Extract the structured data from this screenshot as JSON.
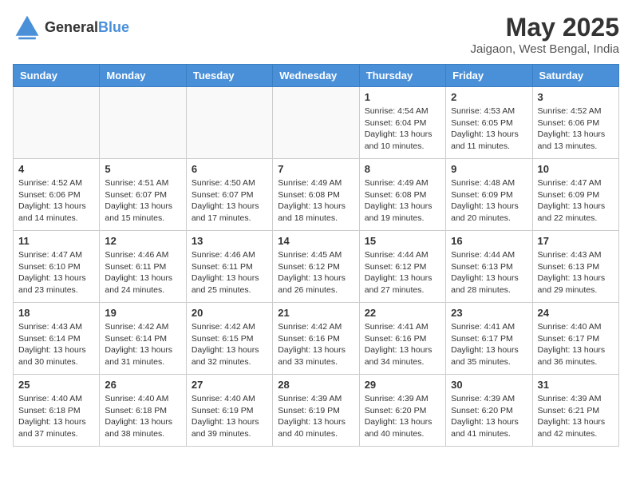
{
  "header": {
    "logo_general": "General",
    "logo_blue": "Blue",
    "month_year": "May 2025",
    "location": "Jaigaon, West Bengal, India"
  },
  "weekdays": [
    "Sunday",
    "Monday",
    "Tuesday",
    "Wednesday",
    "Thursday",
    "Friday",
    "Saturday"
  ],
  "weeks": [
    [
      {
        "day": "",
        "info": ""
      },
      {
        "day": "",
        "info": ""
      },
      {
        "day": "",
        "info": ""
      },
      {
        "day": "",
        "info": ""
      },
      {
        "day": "1",
        "info": "Sunrise: 4:54 AM\nSunset: 6:04 PM\nDaylight: 13 hours and 10 minutes."
      },
      {
        "day": "2",
        "info": "Sunrise: 4:53 AM\nSunset: 6:05 PM\nDaylight: 13 hours and 11 minutes."
      },
      {
        "day": "3",
        "info": "Sunrise: 4:52 AM\nSunset: 6:06 PM\nDaylight: 13 hours and 13 minutes."
      }
    ],
    [
      {
        "day": "4",
        "info": "Sunrise: 4:52 AM\nSunset: 6:06 PM\nDaylight: 13 hours and 14 minutes."
      },
      {
        "day": "5",
        "info": "Sunrise: 4:51 AM\nSunset: 6:07 PM\nDaylight: 13 hours and 15 minutes."
      },
      {
        "day": "6",
        "info": "Sunrise: 4:50 AM\nSunset: 6:07 PM\nDaylight: 13 hours and 17 minutes."
      },
      {
        "day": "7",
        "info": "Sunrise: 4:49 AM\nSunset: 6:08 PM\nDaylight: 13 hours and 18 minutes."
      },
      {
        "day": "8",
        "info": "Sunrise: 4:49 AM\nSunset: 6:08 PM\nDaylight: 13 hours and 19 minutes."
      },
      {
        "day": "9",
        "info": "Sunrise: 4:48 AM\nSunset: 6:09 PM\nDaylight: 13 hours and 20 minutes."
      },
      {
        "day": "10",
        "info": "Sunrise: 4:47 AM\nSunset: 6:09 PM\nDaylight: 13 hours and 22 minutes."
      }
    ],
    [
      {
        "day": "11",
        "info": "Sunrise: 4:47 AM\nSunset: 6:10 PM\nDaylight: 13 hours and 23 minutes."
      },
      {
        "day": "12",
        "info": "Sunrise: 4:46 AM\nSunset: 6:11 PM\nDaylight: 13 hours and 24 minutes."
      },
      {
        "day": "13",
        "info": "Sunrise: 4:46 AM\nSunset: 6:11 PM\nDaylight: 13 hours and 25 minutes."
      },
      {
        "day": "14",
        "info": "Sunrise: 4:45 AM\nSunset: 6:12 PM\nDaylight: 13 hours and 26 minutes."
      },
      {
        "day": "15",
        "info": "Sunrise: 4:44 AM\nSunset: 6:12 PM\nDaylight: 13 hours and 27 minutes."
      },
      {
        "day": "16",
        "info": "Sunrise: 4:44 AM\nSunset: 6:13 PM\nDaylight: 13 hours and 28 minutes."
      },
      {
        "day": "17",
        "info": "Sunrise: 4:43 AM\nSunset: 6:13 PM\nDaylight: 13 hours and 29 minutes."
      }
    ],
    [
      {
        "day": "18",
        "info": "Sunrise: 4:43 AM\nSunset: 6:14 PM\nDaylight: 13 hours and 30 minutes."
      },
      {
        "day": "19",
        "info": "Sunrise: 4:42 AM\nSunset: 6:14 PM\nDaylight: 13 hours and 31 minutes."
      },
      {
        "day": "20",
        "info": "Sunrise: 4:42 AM\nSunset: 6:15 PM\nDaylight: 13 hours and 32 minutes."
      },
      {
        "day": "21",
        "info": "Sunrise: 4:42 AM\nSunset: 6:16 PM\nDaylight: 13 hours and 33 minutes."
      },
      {
        "day": "22",
        "info": "Sunrise: 4:41 AM\nSunset: 6:16 PM\nDaylight: 13 hours and 34 minutes."
      },
      {
        "day": "23",
        "info": "Sunrise: 4:41 AM\nSunset: 6:17 PM\nDaylight: 13 hours and 35 minutes."
      },
      {
        "day": "24",
        "info": "Sunrise: 4:40 AM\nSunset: 6:17 PM\nDaylight: 13 hours and 36 minutes."
      }
    ],
    [
      {
        "day": "25",
        "info": "Sunrise: 4:40 AM\nSunset: 6:18 PM\nDaylight: 13 hours and 37 minutes."
      },
      {
        "day": "26",
        "info": "Sunrise: 4:40 AM\nSunset: 6:18 PM\nDaylight: 13 hours and 38 minutes."
      },
      {
        "day": "27",
        "info": "Sunrise: 4:40 AM\nSunset: 6:19 PM\nDaylight: 13 hours and 39 minutes."
      },
      {
        "day": "28",
        "info": "Sunrise: 4:39 AM\nSunset: 6:19 PM\nDaylight: 13 hours and 40 minutes."
      },
      {
        "day": "29",
        "info": "Sunrise: 4:39 AM\nSunset: 6:20 PM\nDaylight: 13 hours and 40 minutes."
      },
      {
        "day": "30",
        "info": "Sunrise: 4:39 AM\nSunset: 6:20 PM\nDaylight: 13 hours and 41 minutes."
      },
      {
        "day": "31",
        "info": "Sunrise: 4:39 AM\nSunset: 6:21 PM\nDaylight: 13 hours and 42 minutes."
      }
    ]
  ]
}
